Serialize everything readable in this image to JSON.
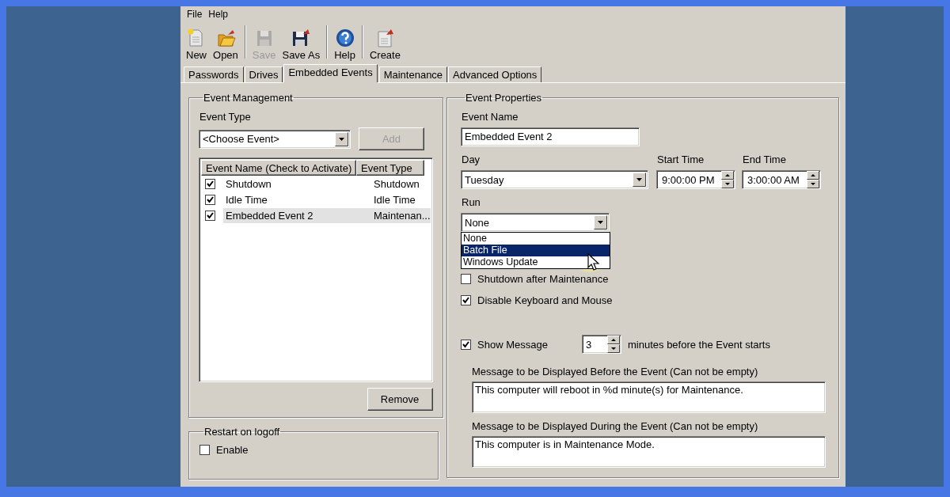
{
  "menu": [
    {
      "label": "File"
    },
    {
      "label": "Help"
    }
  ],
  "toolbar": [
    {
      "kind": "new",
      "label": "New",
      "disabled": false,
      "separator_after": false
    },
    {
      "kind": "open",
      "label": "Open",
      "disabled": false,
      "separator_after": true
    },
    {
      "kind": "save",
      "label": "Save",
      "disabled": true,
      "separator_after": false
    },
    {
      "kind": "saveas",
      "label": "Save As",
      "disabled": false,
      "separator_after": true
    },
    {
      "kind": "help",
      "label": "Help",
      "disabled": false,
      "separator_after": true
    },
    {
      "kind": "create",
      "label": "Create",
      "disabled": false,
      "separator_after": false
    }
  ],
  "tabs": [
    {
      "label": "Passwords",
      "selected": false
    },
    {
      "label": "Drives",
      "selected": false
    },
    {
      "label": "Embedded Events",
      "selected": true
    },
    {
      "label": "Maintenance",
      "selected": false
    },
    {
      "label": "Advanced Options",
      "selected": false
    }
  ],
  "event_management": {
    "title": "Event Management",
    "event_type_label": "Event Type",
    "event_type_value": "<Choose Event>",
    "add_button": {
      "label": "Add",
      "disabled": true
    },
    "columns": [
      "Event Name (Check to Activate)",
      "Event Type"
    ],
    "rows": [
      {
        "name": "Shutdown",
        "type": "Shutdown",
        "checked": true,
        "selected": false
      },
      {
        "name": "Idle Time",
        "type": "Idle Time",
        "checked": true,
        "selected": false
      },
      {
        "name": "Embedded Event 2",
        "type": "Maintenan...",
        "checked": true,
        "selected": true
      }
    ],
    "remove_button": "Remove"
  },
  "restart_on_logoff": {
    "title": "Restart on logoff",
    "label": "Enable",
    "checked": false
  },
  "event_properties": {
    "title": "Event Properties",
    "event_name_label": "Event Name",
    "event_name_value": "Embedded Event 2",
    "day_label": "Day",
    "day_value": "Tuesday",
    "start_time_label": "Start Time",
    "start_time_value": "9:00:00 PM",
    "end_time_label": "End Time",
    "end_time_value": "3:00:00 AM",
    "run_label": "Run",
    "run_value": "None",
    "run_options": [
      {
        "label": "None",
        "selected": false
      },
      {
        "label": "Batch File",
        "selected": true
      },
      {
        "label": "Windows Update",
        "selected": false
      }
    ],
    "options": [
      {
        "label": "Shutdown after Maintenance",
        "checked": false
      },
      {
        "label": "Disable Keyboard and Mouse",
        "checked": true
      }
    ],
    "show_message": {
      "label": "Show Message",
      "checked": true,
      "minutes": "3",
      "suffix": "minutes before the Event starts"
    },
    "messages": [
      {
        "label": "Message to be Displayed Before the Event  (Can not be empty)",
        "value": "This computer will reboot in %d minute(s) for Maintenance."
      },
      {
        "label": "Message to be Displayed During the Event  (Can not be empty)",
        "value": "This computer is in Maintenance Mode."
      }
    ]
  }
}
